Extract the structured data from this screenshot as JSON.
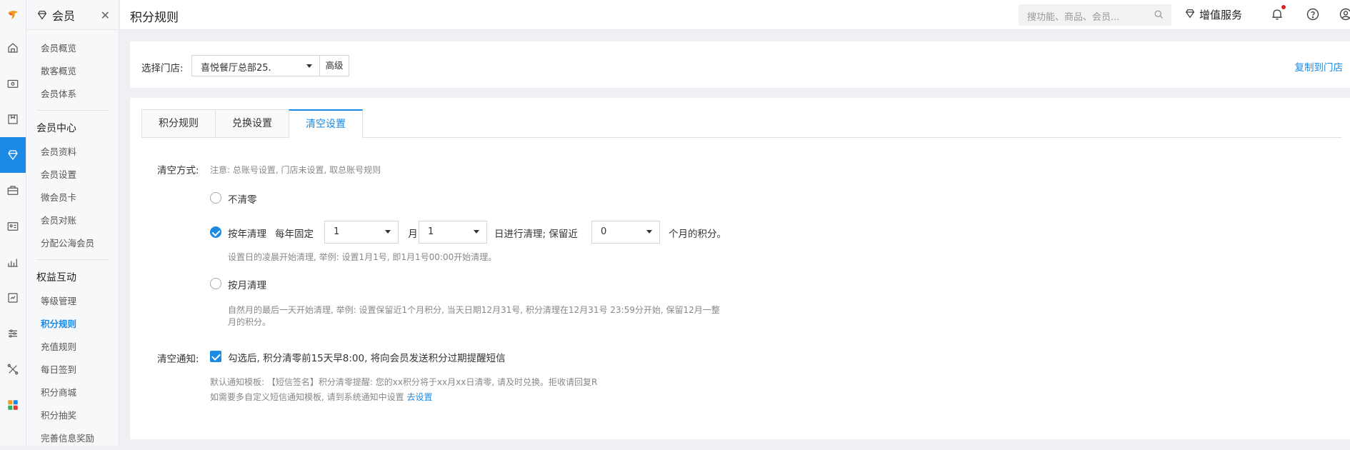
{
  "colors": {
    "accent": "#1a8ae5",
    "background": "#eef0f3"
  },
  "rail": {
    "items": [
      {
        "name": "home-icon",
        "active": false
      },
      {
        "name": "cashier-icon",
        "active": false
      },
      {
        "name": "goods-icon",
        "active": false
      },
      {
        "name": "member-icon",
        "active": true
      },
      {
        "name": "marketing-icon",
        "active": false
      },
      {
        "name": "staff-icon",
        "active": false
      },
      {
        "name": "report-icon",
        "active": false
      },
      {
        "name": "finance-icon",
        "active": false
      },
      {
        "name": "settings-icon",
        "active": false
      },
      {
        "name": "tools-icon",
        "active": false
      },
      {
        "name": "apps-icon",
        "active": false
      }
    ]
  },
  "menu": {
    "title": "会员",
    "items_top": [
      "会员概览",
      "散客概览",
      "会员体系"
    ],
    "group1": "会员中心",
    "items_center": [
      "会员资料",
      "会员设置",
      "微会员卡",
      "会员对账",
      "分配公海会员"
    ],
    "group2": "权益互动",
    "items_rights": [
      "等级管理",
      "积分规则",
      "充值规则",
      "每日签到",
      "积分商城",
      "积分抽奖",
      "完善信息奖励"
    ]
  },
  "header": {
    "title": "积分规则",
    "search_placeholder": "搜功能、商品、会员...",
    "value_added": "增值服务"
  },
  "store_bar": {
    "label": "选择门店:",
    "store_value": "喜悦餐厅总部25.",
    "advanced": "高级",
    "copy_link": "复制到门店"
  },
  "tabs": [
    "积分规则",
    "兑换设置",
    "清空设置"
  ],
  "active_tab": 2,
  "clear": {
    "method_label": "清空方式:",
    "method_note": "注意: 总账号设置, 门店未设置, 取总账号规则",
    "opt_none": "不清零",
    "opt_year": "按年清理",
    "year_fixed": "每年固定",
    "month_value": "1",
    "month_unit": "月",
    "day_value": "1",
    "day_text": "日进行清理; 保留近",
    "keep_value": "0",
    "keep_unit": "个月的积分。",
    "year_hint": "设置日的凌晨开始清理, 举例: 设置1月1号, 即1月1号00:00开始清理。",
    "opt_month": "按月清理",
    "month_hint_1": "自然月的最后一天开始清理, 举例: 设置保留近1个月积分, 当天日期12月31号, 积分清理在12月31号 23:59分开始, 保留12月一整",
    "month_hint_2": "月的积分。",
    "notify_label": "清空通知:",
    "notify_text": "勾选后, 积分清零前15天早8:00, 将向会员发送积分过期提醒短信",
    "template_note": "默认通知模板: 【短信签名】积分清零提醒: 您的xx积分将于xx月xx日清零, 请及时兑换。拒收请回复R",
    "custom_note": "如需要多自定义短信通知模板, 请到系统通知中设置",
    "custom_link": "去设置"
  }
}
